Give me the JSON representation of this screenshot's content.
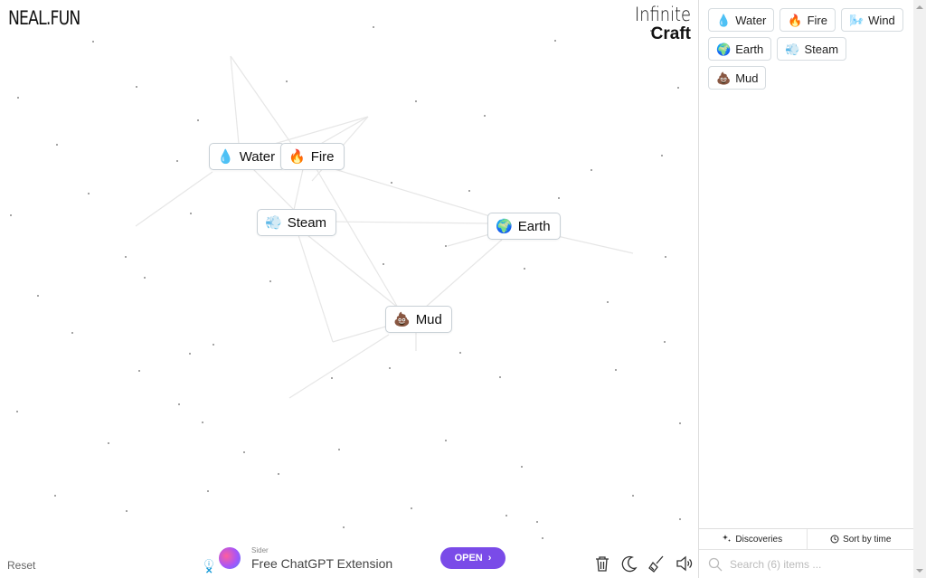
{
  "header": {
    "logo": "NEAL.FUN",
    "brand_line1": "Infinite",
    "brand_line2": "Craft"
  },
  "canvas": {
    "elements": [
      {
        "name": "Water",
        "emoji": "💧",
        "icon": "water-drop-icon"
      },
      {
        "name": "Fire",
        "emoji": "🔥",
        "icon": "fire-icon"
      },
      {
        "name": "Steam",
        "emoji": "💨",
        "icon": "steam-icon"
      },
      {
        "name": "Earth",
        "emoji": "🌍",
        "icon": "earth-globe-icon"
      },
      {
        "name": "Mud",
        "emoji": "💩",
        "icon": "mud-icon"
      }
    ],
    "reset_label": "Reset"
  },
  "ad": {
    "sponsor": "Sider",
    "headline": "Free ChatGPT Extension",
    "cta": "OPEN",
    "info_glyph": "ⓘ",
    "close_glyph": "✕"
  },
  "toolbar": {
    "tools": [
      {
        "name": "clear",
        "icon": "trash-icon"
      },
      {
        "name": "dark-mode",
        "icon": "moon-icon"
      },
      {
        "name": "cleanup",
        "icon": "broom-icon"
      },
      {
        "name": "sound",
        "icon": "speaker-icon"
      }
    ]
  },
  "sidebar": {
    "items": [
      {
        "name": "Water",
        "emoji": "💧",
        "icon": "water-drop-icon"
      },
      {
        "name": "Fire",
        "emoji": "🔥",
        "icon": "fire-icon"
      },
      {
        "name": "Wind",
        "emoji": "🌬️",
        "icon": "wind-icon"
      },
      {
        "name": "Earth",
        "emoji": "🌍",
        "icon": "earth-globe-icon"
      },
      {
        "name": "Steam",
        "emoji": "💨",
        "icon": "steam-icon"
      },
      {
        "name": "Mud",
        "emoji": "💩",
        "icon": "mud-icon"
      }
    ],
    "tabs": {
      "discoveries": "Discoveries",
      "sort": "Sort by time"
    },
    "search_placeholder": "Search (6) items ..."
  }
}
